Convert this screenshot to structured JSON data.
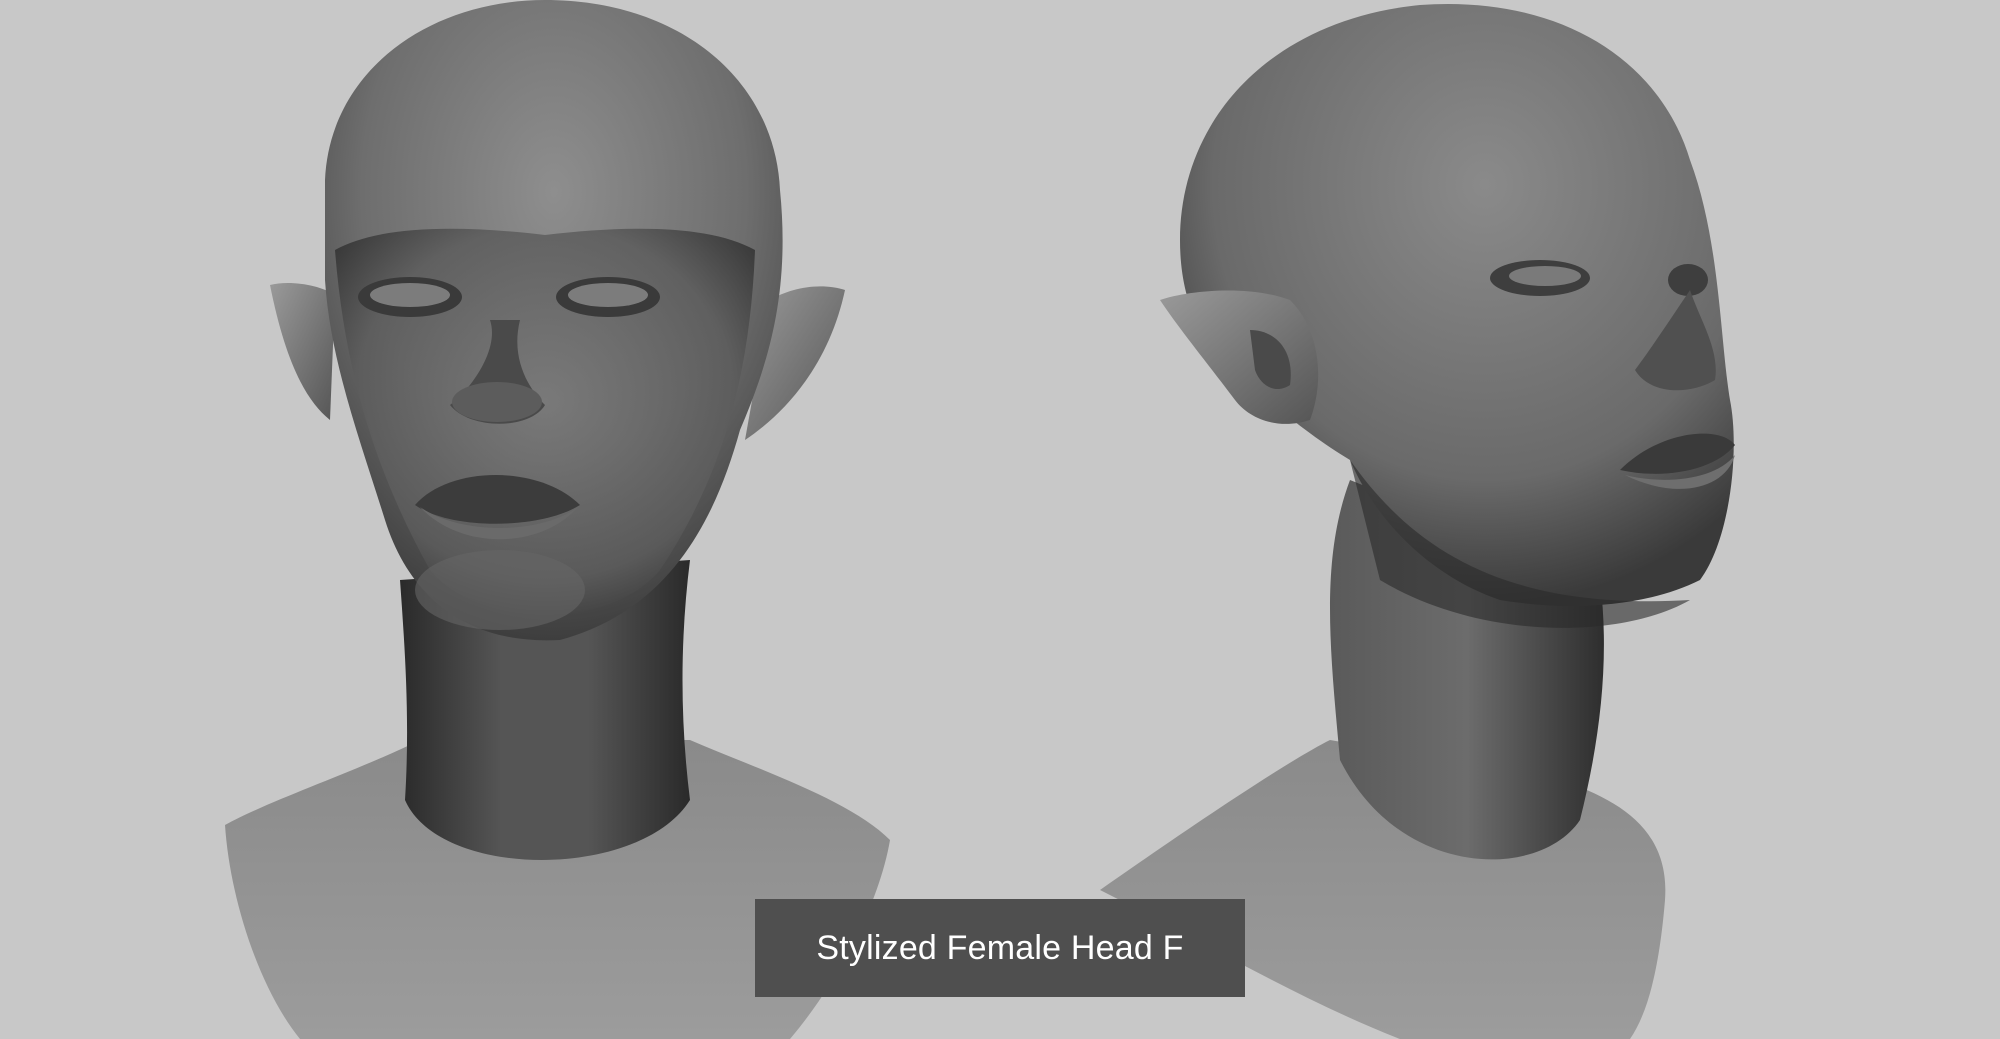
{
  "caption": {
    "title": "Stylized Female Head F"
  },
  "scene": {
    "background_color": "#c8c8c8",
    "model_color": "#6a6a6a",
    "caption_bg_color": "#4f4f4f",
    "views": [
      "front-view",
      "three-quarter-view"
    ]
  }
}
